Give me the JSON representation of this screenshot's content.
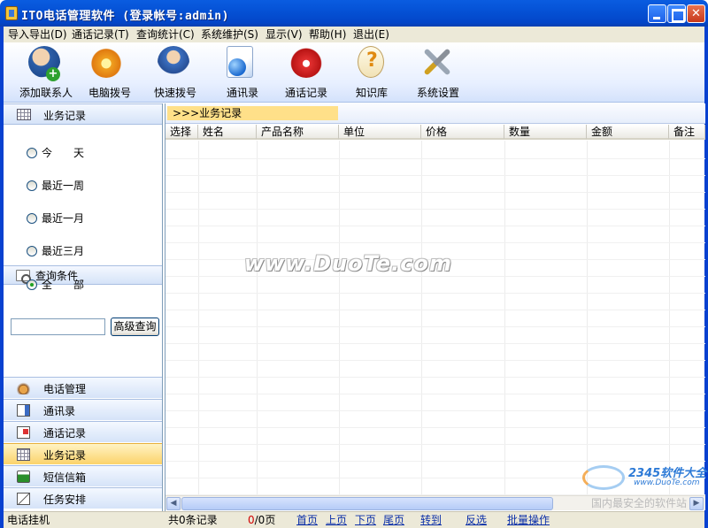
{
  "window": {
    "title": "ITO电话管理软件 (登录帐号:admin)"
  },
  "menu": [
    "导入导出(D)",
    "通话记录(T)",
    "查询统计(C)",
    "系统维护(S)",
    "显示(V)",
    "帮助(H)",
    "退出(E)"
  ],
  "toolbar": [
    {
      "label": "添加联系人",
      "icon": "add-contact-icon"
    },
    {
      "label": "电脑拨号",
      "icon": "phone-dial-icon"
    },
    {
      "label": "快速拨号",
      "icon": "quick-dial-icon"
    },
    {
      "label": "通讯录",
      "icon": "address-book-icon"
    },
    {
      "label": "通话记录",
      "icon": "call-log-icon"
    },
    {
      "label": "知识库",
      "icon": "knowledge-base-icon"
    },
    {
      "label": "系统设置",
      "icon": "settings-icon"
    }
  ],
  "sidebar": {
    "records_header": "业务记录",
    "time_filters": [
      {
        "label": "今　　天",
        "selected": false
      },
      {
        "label": "最近一周",
        "selected": false
      },
      {
        "label": "最近一月",
        "selected": false
      },
      {
        "label": "最近三月",
        "selected": false
      }
    ],
    "query_header": "查询条件",
    "all_option": {
      "label": "全　　部",
      "selected": true
    },
    "search_value": "",
    "advanced_query_label": "高级查询",
    "nav": [
      {
        "label": "电话管理",
        "icon": "telephone-icon",
        "active": false
      },
      {
        "label": "通讯录",
        "icon": "address-book-icon",
        "active": false
      },
      {
        "label": "通话记录",
        "icon": "call-log-icon",
        "active": false
      },
      {
        "label": "业务记录",
        "icon": "grid-icon",
        "active": true
      },
      {
        "label": "短信信箱",
        "icon": "sms-icon",
        "active": false
      },
      {
        "label": "任务安排",
        "icon": "task-icon",
        "active": false
      }
    ]
  },
  "main": {
    "breadcrumb": ">>>业务记录",
    "columns": [
      "选择",
      "姓名",
      "产品名称",
      "单位",
      "价格",
      "数量",
      "金额",
      "备注"
    ],
    "rows": []
  },
  "watermark": "www.DuoTe.com",
  "corner_logo": {
    "line1": "2345软件大全",
    "line2": "www.DuoTe.com",
    "slogan": "国内最安全的软件站"
  },
  "statusbar": {
    "hangup": "电话挂机",
    "total": "共0条记录",
    "page_current": "0",
    "page_total": "/0页",
    "first": "首页",
    "prev": "上页",
    "next": "下页",
    "last": "尾页",
    "goto": "转到",
    "invert": "反选",
    "batch": "批量操作"
  },
  "colors": {
    "titlebar": "#0552d6",
    "active_nav": "#fbd36a",
    "breadcrumb": "#ffe089",
    "page_current": "#d00000"
  }
}
